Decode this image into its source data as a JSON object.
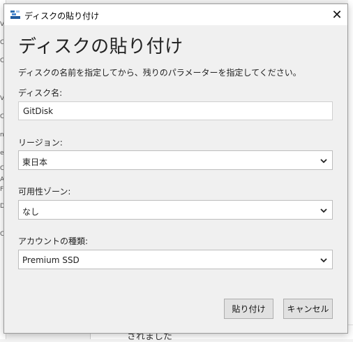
{
  "background": {
    "left_chars": [
      "V",
      "C",
      "C",
      "V",
      "C",
      "n",
      "e",
      "C",
      "A",
      "F",
      "D",
      "C"
    ],
    "bottom_text": "されました"
  },
  "dialog": {
    "window_title": "ディスクの貼り付け",
    "heading": "ディスクの貼り付け",
    "description": "ディスクの名前を指定してから、残りのパラメーターを指定してください。",
    "disk_name": {
      "label": "ディスク名:",
      "value": "GitDisk"
    },
    "region": {
      "label": "リージョン:",
      "selected": "東日本"
    },
    "availability_zone": {
      "label": "可用性ゾーン:",
      "selected": "なし"
    },
    "account_type": {
      "label": "アカウントの種類:",
      "selected": "Premium SSD"
    },
    "buttons": {
      "paste": "貼り付け",
      "cancel": "キャンセル"
    },
    "close_glyph": "✕"
  },
  "colors": {
    "dialog_bg": "#f0f0f0",
    "accent_icon": "#2b6cb0"
  }
}
